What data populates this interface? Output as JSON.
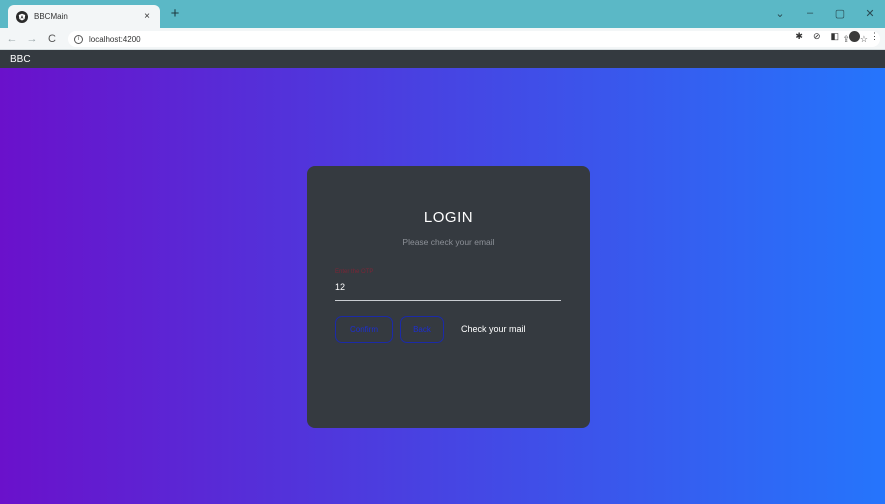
{
  "browser": {
    "tab_title": "BBCMain",
    "tab_close": "×",
    "new_tab": "+",
    "url": "localhost:4200",
    "window_controls": {
      "dropdown": "⌄",
      "minimize": "–",
      "restore": "▢",
      "close": "✕"
    }
  },
  "app": {
    "brand": "BBC"
  },
  "login": {
    "title": "LOGIN",
    "subtitle": "Please check your email",
    "otp_label": "Enter the OTP",
    "otp_value": "12",
    "confirm_label": "Confirm",
    "back_label": "Back",
    "status_message": "Check your mail"
  },
  "colors": {
    "gradient_start": "#6a11cb",
    "gradient_end": "#2575fc",
    "card_bg": "#353a40",
    "header_bg": "#343a40",
    "button_border": "#1b2aa8",
    "tab_strip": "#5bb8c6"
  }
}
